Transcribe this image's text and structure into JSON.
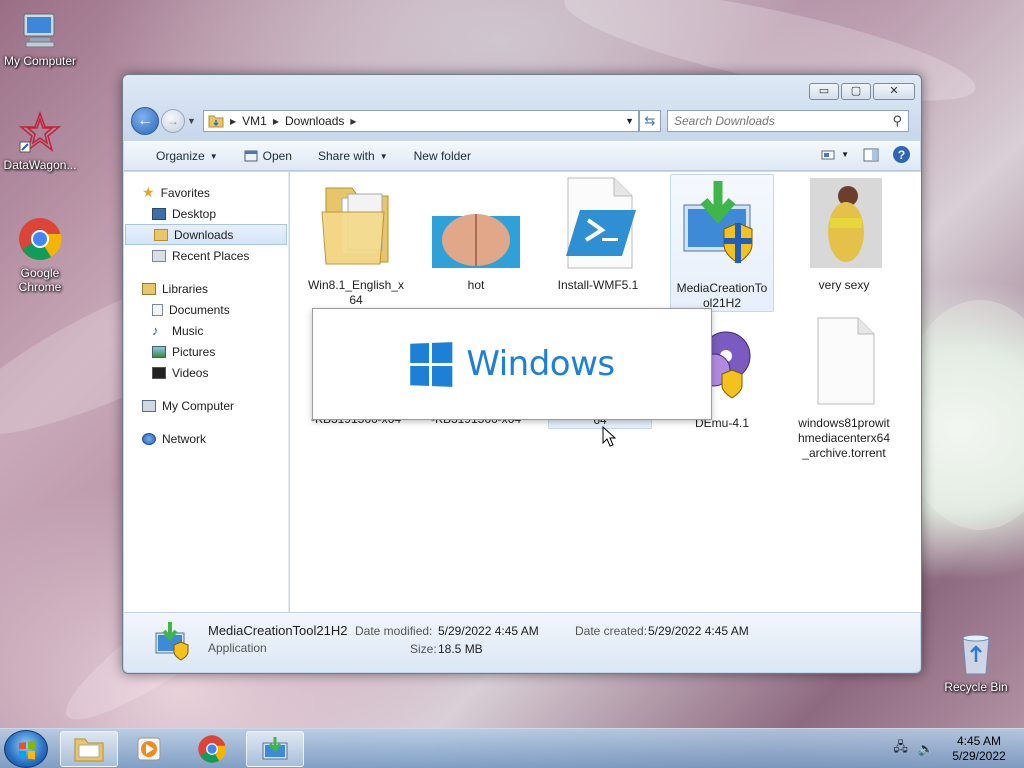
{
  "desktop": {
    "icons": [
      {
        "label": "My Computer"
      },
      {
        "label": "DataWagon..."
      },
      {
        "label": "Google Chrome"
      },
      {
        "label": "Recycle Bin"
      }
    ]
  },
  "window": {
    "controls": {
      "minimize": "▭",
      "maximize": "▢",
      "close": "✕"
    },
    "breadcrumb": [
      "VM1",
      "Downloads"
    ],
    "search_placeholder": "Search Downloads",
    "toolbar": {
      "organize": "Organize",
      "open": "Open",
      "share_with": "Share with",
      "new_folder": "New folder"
    },
    "sidebar": {
      "favorites": "Favorites",
      "favorites_items": [
        "Desktop",
        "Downloads",
        "Recent Places"
      ],
      "libraries": "Libraries",
      "libraries_items": [
        "Documents",
        "Music",
        "Pictures",
        "Videos"
      ],
      "my_computer": "My Computer",
      "network": "Network"
    },
    "files": [
      {
        "name": "Win8.1_English_x64",
        "line1": "Win8.1_English_x",
        "line2": "64"
      },
      {
        "name": "hot"
      },
      {
        "name": "Install-WMF5.1"
      },
      {
        "name": "MediaCreationTool21H2",
        "line1": "MediaCreationTo",
        "line2": "ol21H2"
      },
      {
        "name": "very sexy"
      },
      {
        "name": "-KB3191566-x64"
      },
      {
        "name": "-KB3191566-x64"
      },
      {
        "name": "64"
      },
      {
        "name": "DEmu-4.1"
      },
      {
        "name": "windows81prowithmediacenterx64_archive.torrent",
        "line1": "windows81prowit",
        "line2": "hmediacenterx64",
        "line3": "_archive.torrent"
      }
    ],
    "splash": {
      "word": "Windows"
    },
    "details": {
      "name": "MediaCreationTool21H2",
      "type": "Application",
      "date_modified_label": "Date modified:",
      "date_modified": "5/29/2022 4:45 AM",
      "date_created_label": "Date created:",
      "date_created": "5/29/2022 4:45 AM",
      "size_label": "Size:",
      "size": "18.5 MB"
    }
  },
  "taskbar": {
    "time": "4:45 AM",
    "date": "5/29/2022"
  },
  "colors": {
    "accent": "#1d7fd6",
    "selection": "#d3e4f7"
  }
}
